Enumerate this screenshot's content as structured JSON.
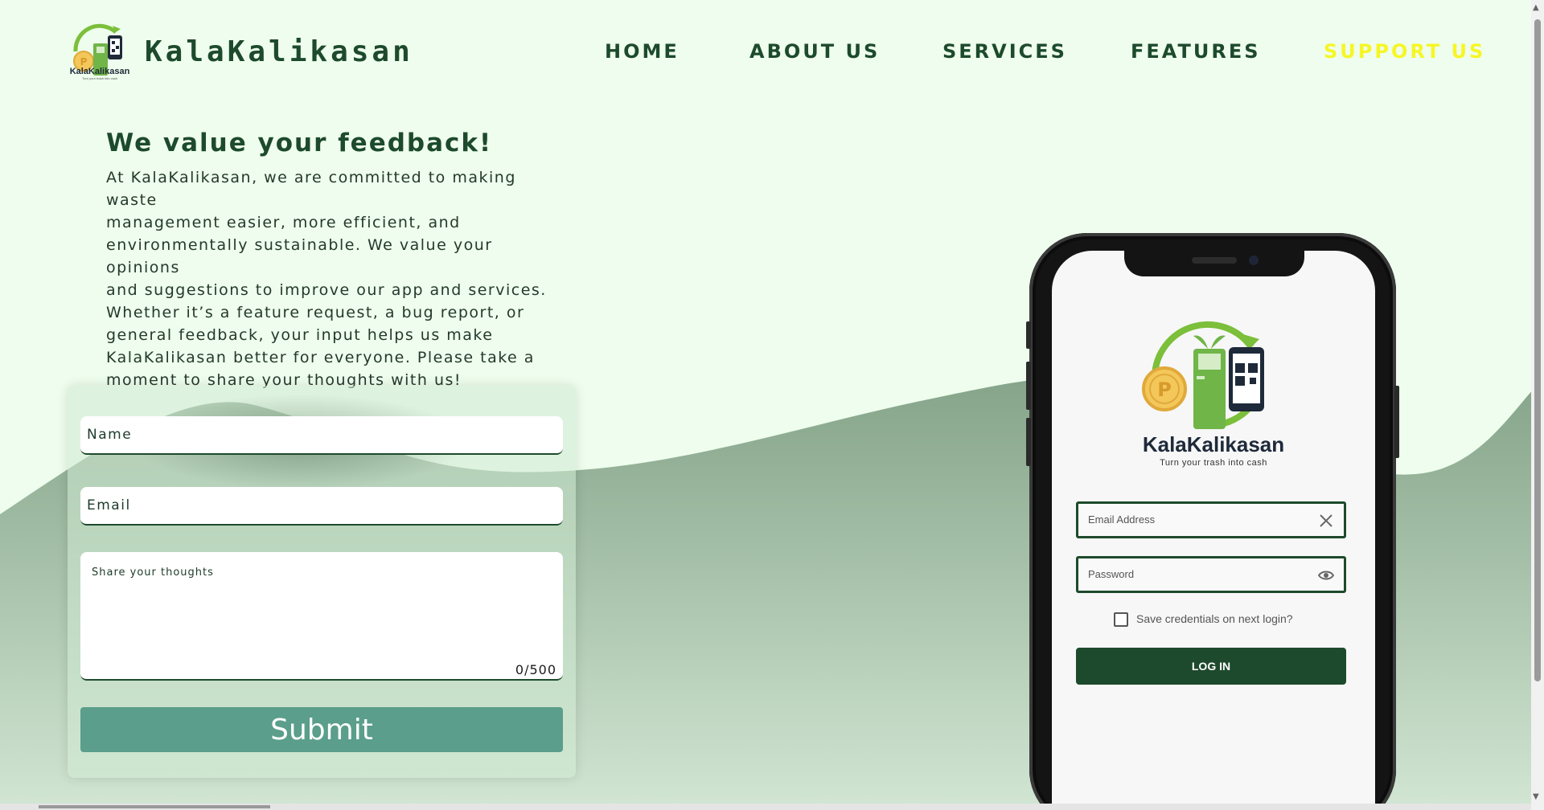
{
  "brand": {
    "name": "KalaKalikasan",
    "logo_small_name": "KalaKalikasan",
    "logo_small_tagline": "Turn your trash into cash"
  },
  "nav": {
    "items": [
      {
        "label": "HOME",
        "active": false
      },
      {
        "label": "ABOUT US",
        "active": false
      },
      {
        "label": "SERVICES",
        "active": false
      },
      {
        "label": "FEATURES",
        "active": false
      },
      {
        "label": "SUPPORT US",
        "active": true
      }
    ]
  },
  "feedback": {
    "title": "We value your feedback!",
    "lines": [
      "At KalaKalikasan, we are committed to making waste",
      "management easier, more efficient, and",
      "environmentally sustainable. We value your opinions",
      "and suggestions to improve our app and services.",
      "Whether it’s a feature request, a bug report, or",
      "general feedback, your input helps us make",
      "KalaKalikasan better for everyone. Please take a",
      "moment to share your thoughts with us!"
    ]
  },
  "form": {
    "name_placeholder": "Name",
    "email_placeholder": "Email",
    "thoughts_placeholder": "Share your thoughts",
    "counter": "0/500",
    "submit_label": "Submit"
  },
  "phone_app": {
    "name": "KalaKalikasan",
    "tagline": "Turn your trash into cash",
    "email_placeholder": "Email Address",
    "password_placeholder": "Password",
    "save_credentials_label": "Save credentials on next login?",
    "login_label": "LOG IN"
  },
  "colors": {
    "background": "#eefded",
    "primary_dark_green": "#1d4a2c",
    "active_nav": "#f6f625",
    "submit_button": "#5a9e8b",
    "wave": "#8aa98e"
  }
}
